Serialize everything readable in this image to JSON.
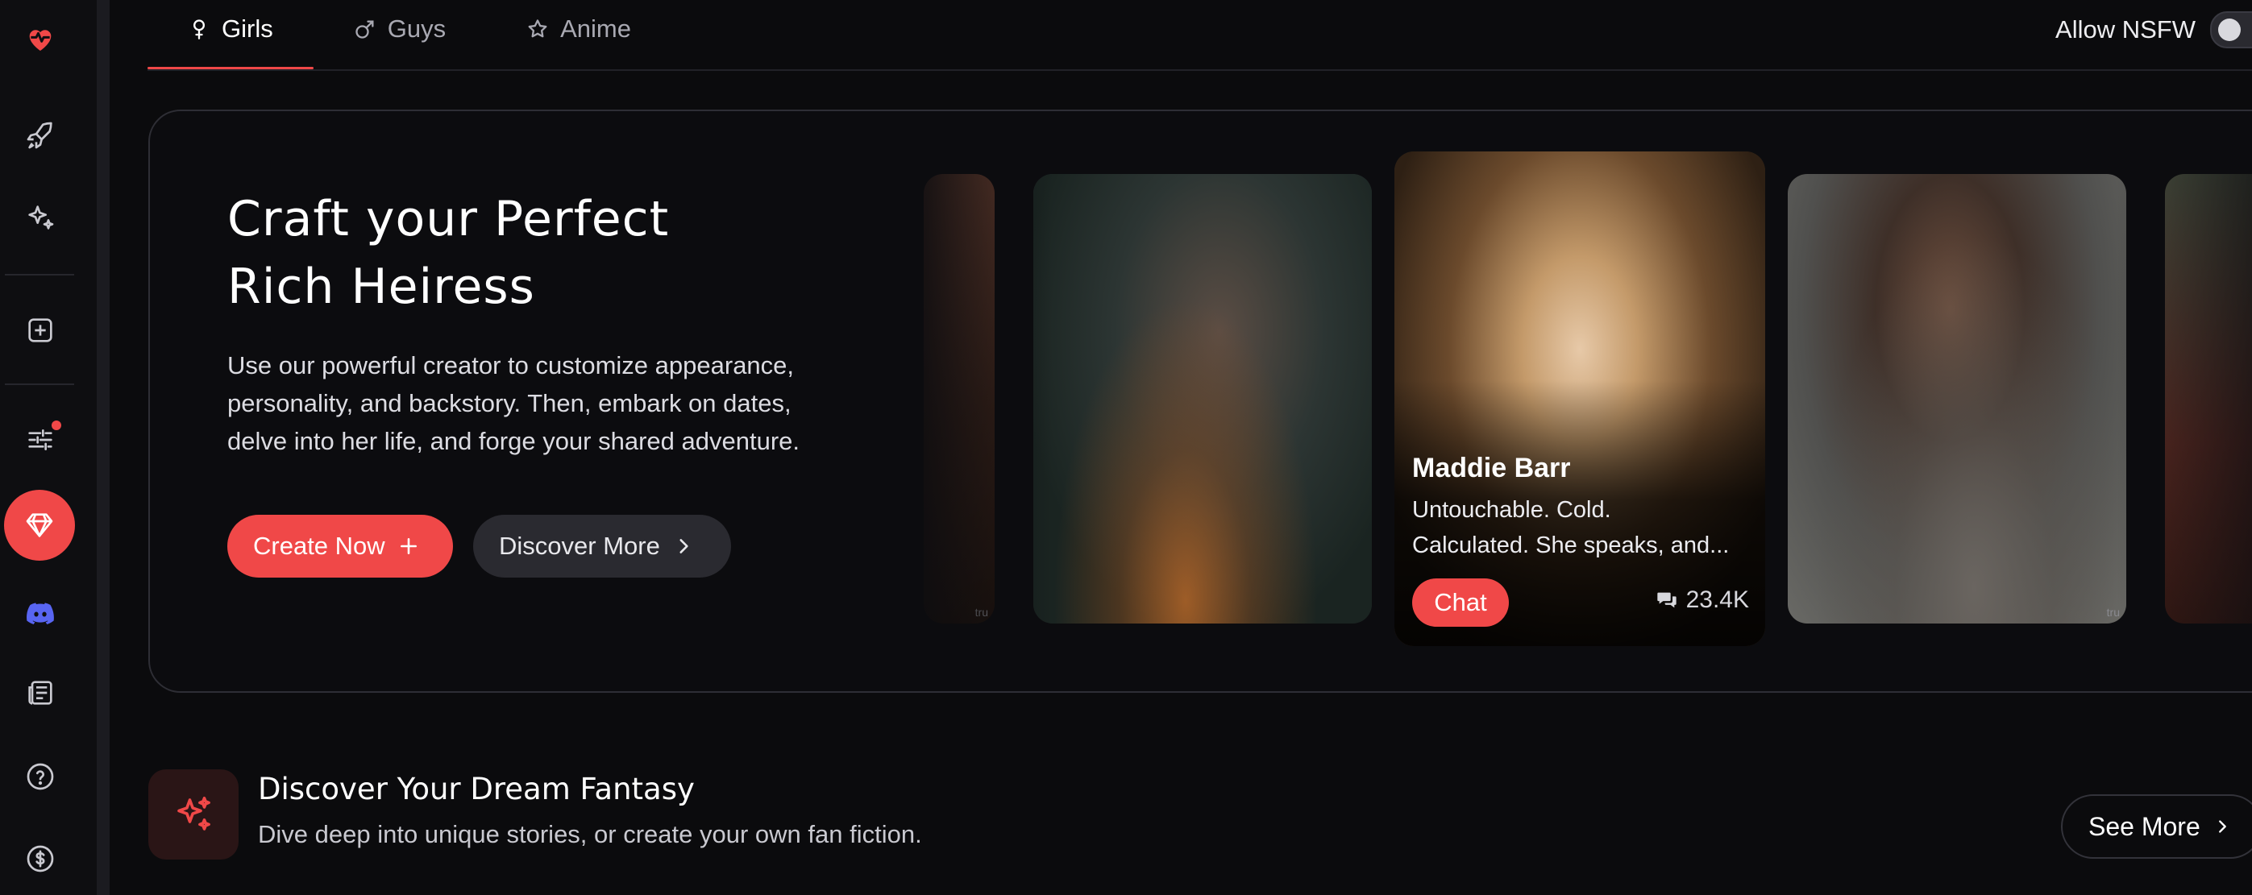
{
  "nav": {
    "tabs": [
      {
        "label": "Girls",
        "active": true
      },
      {
        "label": "Guys",
        "active": false
      },
      {
        "label": "Anime",
        "active": false
      }
    ],
    "nsfw_label": "Allow NSFW",
    "nsfw_enabled": false
  },
  "sidebar": {
    "icons": [
      "heart-pulse-logo-icon",
      "rocket-icon",
      "sparkles-icon",
      "plus-square-icon",
      "sliders-icon",
      "diamond-premium-icon",
      "discord-icon",
      "news-icon",
      "help-icon",
      "dollar-icon"
    ],
    "filters_badge": true
  },
  "hero": {
    "title_line1": "Craft your Perfect",
    "title_line2": "Rich Heiress",
    "desc_line1": "Use our powerful creator to customize appearance,",
    "desc_line2": "personality, and backstory. Then, embark on dates,",
    "desc_line3": "delve into her life, and forge your shared adventure.",
    "create_label": "Create Now",
    "discover_label": "Discover More"
  },
  "featured_card": {
    "name": "Maddie Barr",
    "blurb_line1": "Untouchable. Cold.",
    "blurb_line2": "Calculated. She speaks, and...",
    "chat_label": "Chat",
    "chat_count": "23.4K"
  },
  "watermark": "tru",
  "section": {
    "title": "Discover Your Dream Fantasy",
    "subtitle": "Dive deep into unique stories, or create your own fan fiction.",
    "see_more_label": "See More"
  },
  "colors": {
    "accent": "#f04848",
    "background": "#0b0b0d",
    "surface": "#2a2a30"
  }
}
